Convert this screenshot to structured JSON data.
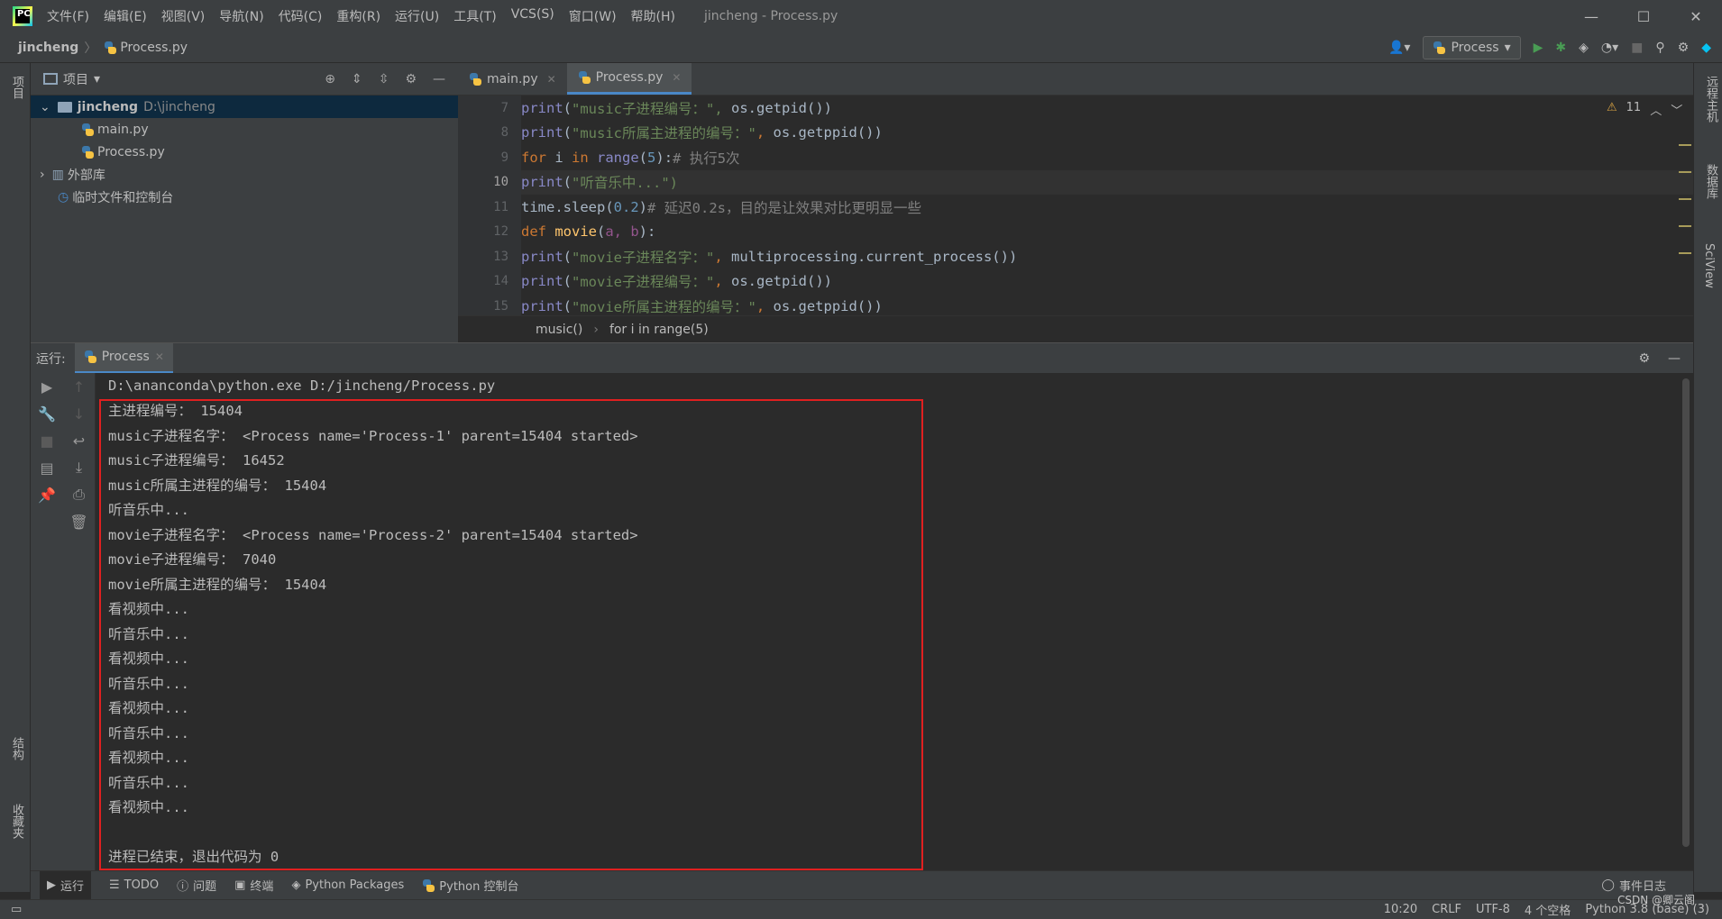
{
  "menu": [
    "文件(F)",
    "编辑(E)",
    "视图(V)",
    "导航(N)",
    "代码(C)",
    "重构(R)",
    "运行(U)",
    "工具(T)",
    "VCS(S)",
    "窗口(W)",
    "帮助(H)"
  ],
  "window_title": "jincheng - Process.py",
  "breadcrumb": {
    "project": "jincheng",
    "file": "Process.py"
  },
  "run_config": "Process",
  "left_strip": {
    "project": "项目",
    "structure": "结构",
    "favorites": "收藏夹"
  },
  "right_strip": {
    "remote": "远程主机",
    "database": "数据库",
    "sciview": "SciView"
  },
  "project_panel": {
    "title": "项目",
    "tree": [
      {
        "label": "jincheng",
        "hint": "D:\\jincheng",
        "type": "root"
      },
      {
        "label": "main.py",
        "type": "file"
      },
      {
        "label": "Process.py",
        "type": "file"
      },
      {
        "label": "外部库",
        "type": "lib"
      },
      {
        "label": "临时文件和控制台",
        "type": "scratch"
      }
    ]
  },
  "editor_tabs": [
    {
      "label": "main.py"
    },
    {
      "label": "Process.py",
      "active": true
    }
  ],
  "warnings": "11",
  "line_numbers": [
    "7",
    "8",
    "9",
    "10",
    "11",
    "12",
    "13",
    "14",
    "15"
  ],
  "code_breadcrumb": [
    "music()",
    "for i in range(5)"
  ],
  "run_panel": {
    "label": "运行:",
    "tab": "Process"
  },
  "console": {
    "command": "D:\\ananconda\\python.exe D:/jincheng/Process.py",
    "lines": [
      "主进程编号： 15404",
      "music子进程名字： <Process name='Process-1' parent=15404 started>",
      "music子进程编号： 16452",
      "music所属主进程的编号： 15404",
      "听音乐中...",
      "movie子进程名字： <Process name='Process-2' parent=15404 started>",
      "movie子进程编号： 7040",
      "movie所属主进程的编号： 15404",
      "看视频中...",
      "听音乐中...",
      "看视频中...",
      "听音乐中...",
      "看视频中...",
      "听音乐中...",
      "看视频中...",
      "听音乐中...",
      "看视频中...",
      "",
      "进程已结束，退出代码为 0"
    ]
  },
  "bottom_tabs": [
    "运行",
    "TODO",
    "问题",
    "终端",
    "Python Packages",
    "Python 控制台"
  ],
  "event_log": "事件日志",
  "status": {
    "position": "10:20",
    "line_sep": "CRLF",
    "encoding": "UTF-8",
    "indent": "4 个空格",
    "interpreter": "Python 3.8 (base) (3)"
  },
  "watermark": "CSDN @卿云阁",
  "colors": {
    "accent": "#4a88c7",
    "error_box": "#e02020",
    "run_green": "#499c54"
  }
}
